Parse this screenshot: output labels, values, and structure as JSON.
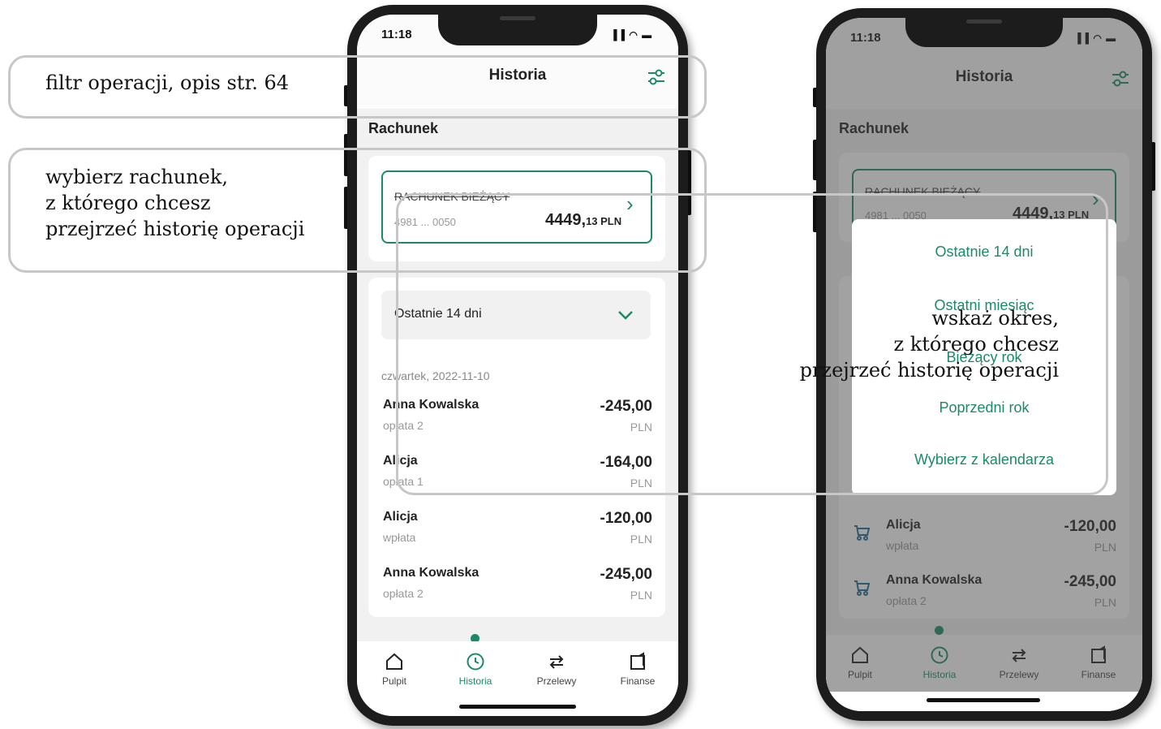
{
  "phone1": {
    "time": "11:18",
    "signal": "▐▐ ◠ ▬",
    "title": "Historia",
    "filter_icon": "sliders-icon",
    "section_label": "Rachunek",
    "account": {
      "name": "RACHUNEK BIEŻĄCY",
      "number": "4981 ... 0050",
      "amount_int": "4449,",
      "amount_dec": "13 PLN"
    },
    "period": "Ostatnie 14 dni",
    "date_label": "czwartek, 2022-11-10",
    "transactions": [
      {
        "name": "Anna Kowalska",
        "sub": "opłata 2",
        "amount": "-245,00",
        "currency": "PLN"
      },
      {
        "name": "Alicja",
        "sub": "opłata 1",
        "amount": "-164,00",
        "currency": "PLN"
      },
      {
        "name": "Alicja",
        "sub": "wpłata",
        "amount": "-120,00",
        "currency": "PLN"
      },
      {
        "name": "Anna Kowalska",
        "sub": "opłata 2",
        "amount": "-245,00",
        "currency": "PLN"
      }
    ],
    "tabs": [
      {
        "label": "Pulpit",
        "icon": "home-icon"
      },
      {
        "label": "Historia",
        "icon": "history-icon",
        "active": true
      },
      {
        "label": "Przelewy",
        "icon": "transfer-icon"
      },
      {
        "label": "Finanse",
        "icon": "finance-icon"
      }
    ]
  },
  "phone2": {
    "time": "11:18",
    "signal": "▐▐ ◠ ▬",
    "title": "Historia",
    "section_label": "Rachunek",
    "account": {
      "name": "RACHUNEK BIEŻĄCY",
      "number": "4981 ... 0050",
      "amount_int": "4449,",
      "amount_dec": "13 PLN"
    },
    "period_options": [
      "Ostatnie 14 dni",
      "Ostatni miesiąc",
      "Bieżący rok",
      "Poprzedni rok",
      "Wybierz z kalendarza"
    ],
    "transactions": [
      {
        "name": "Alicja",
        "sub": "wpłata",
        "amount": "-120,00",
        "currency": "PLN"
      },
      {
        "name": "Anna Kowalska",
        "sub": "opłata 2",
        "amount": "-245,00",
        "currency": "PLN"
      }
    ],
    "tabs": [
      {
        "label": "Pulpit",
        "icon": "home-icon"
      },
      {
        "label": "Historia",
        "icon": "history-icon",
        "active": true
      },
      {
        "label": "Przelewy",
        "icon": "transfer-icon"
      },
      {
        "label": "Finanse",
        "icon": "finance-icon"
      }
    ]
  },
  "callouts": {
    "filter": "filtr operacji, opis str. 64",
    "account_lines": [
      "wybierz rachunek,",
      "z którego chcesz",
      "przejrzeć historię operacji"
    ],
    "period_lines": [
      "wskaż okres,",
      "z którego chcesz",
      "przejrzeć historię operacji"
    ]
  },
  "colors": {
    "accent": "#1a8a68",
    "frame": "#1c1c1c",
    "callout_border": "#c7c7c7"
  }
}
